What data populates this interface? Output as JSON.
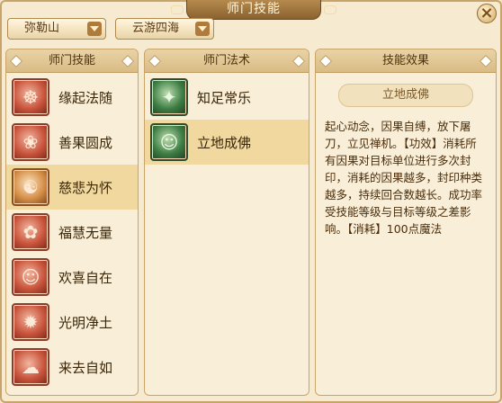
{
  "window": {
    "title": "师门技能",
    "close_glyph": "×"
  },
  "dropdowns": {
    "sect": "弥勒山",
    "branch": "云游四海"
  },
  "panels": {
    "skills_header": "师门技能",
    "methods_header": "师门法术",
    "effect_header": "技能效果"
  },
  "skills": [
    {
      "label": "缘起法随",
      "icon": "skill-icon-yuanqi",
      "glyph": "☸"
    },
    {
      "label": "善果圆成",
      "icon": "skill-icon-shanguo",
      "glyph": "❀"
    },
    {
      "label": "慈悲为怀",
      "icon": "skill-icon-cibei",
      "glyph": "☯"
    },
    {
      "label": "福慧无量",
      "icon": "skill-icon-fuhui",
      "glyph": "✿"
    },
    {
      "label": "欢喜自在",
      "icon": "skill-icon-huanxi",
      "glyph": "☺"
    },
    {
      "label": "光明净土",
      "icon": "skill-icon-guangming",
      "glyph": "✹"
    },
    {
      "label": "来去自如",
      "icon": "skill-icon-laiqu",
      "glyph": "☁"
    }
  ],
  "methods": [
    {
      "label": "知足常乐",
      "icon": "method-icon-zhizu",
      "glyph": "✦"
    },
    {
      "label": "立地成佛",
      "icon": "method-icon-lidi",
      "glyph": "☺"
    }
  ],
  "effect": {
    "name": "立地成佛",
    "description": "起心动念，因果自缚，放下屠刀，立见禅机。【功效】消耗所有因果对目标单位进行多次封印，消耗的因果越多，封印种类越多，持续回合数越长。成功率受技能等级与目标等级之差影响。【消耗】100点魔法"
  },
  "colors": {
    "accent": "#c9a46a",
    "selected": "#f1d89f",
    "text": "#3a2608"
  }
}
